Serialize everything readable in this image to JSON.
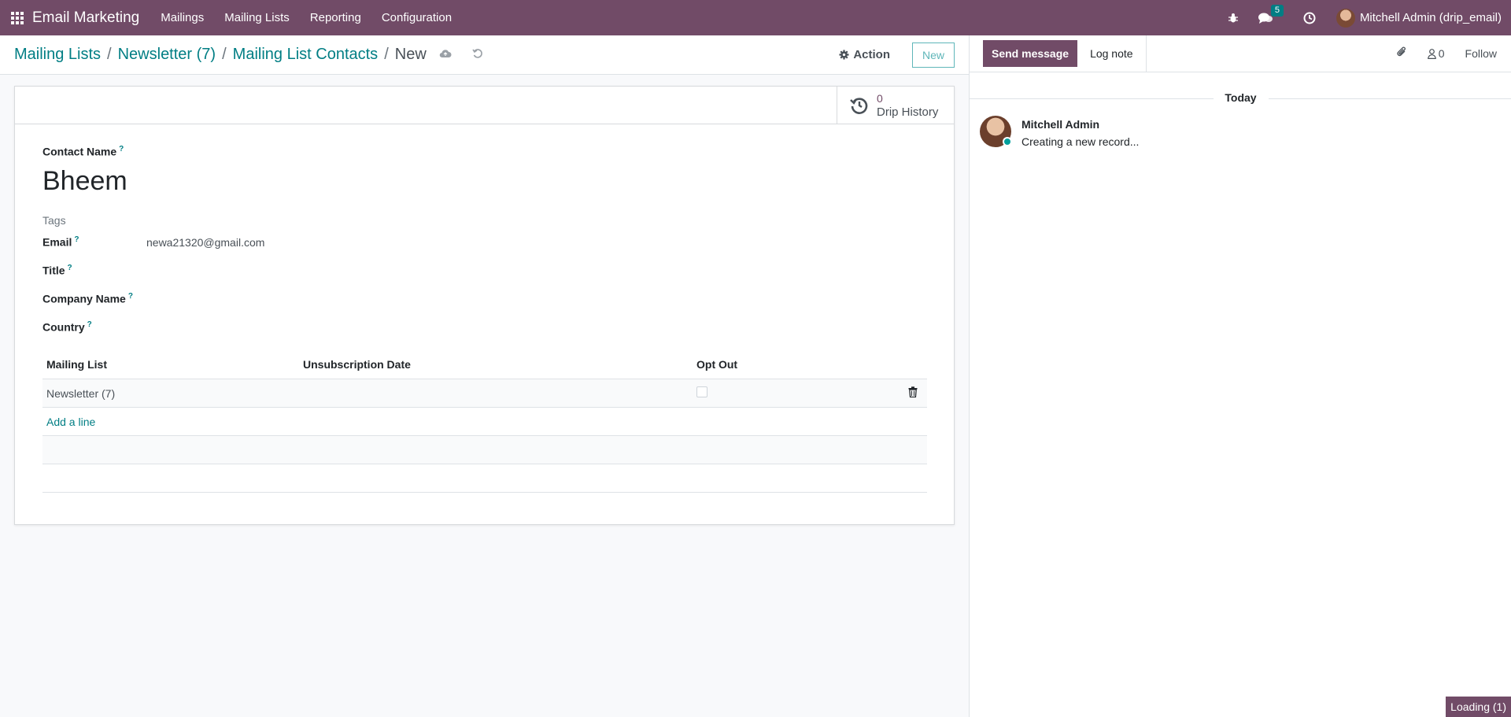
{
  "navbar": {
    "app_name": "Email Marketing",
    "menu": [
      "Mailings",
      "Mailing Lists",
      "Reporting",
      "Configuration"
    ],
    "messages_badge": "5",
    "user": "Mitchell Admin (drip_email)"
  },
  "breadcrumb": {
    "items": [
      "Mailing Lists",
      "Newsletter (7)",
      "Mailing List Contacts"
    ],
    "current": "New"
  },
  "control_panel": {
    "action_label": "Action",
    "new_label": "New"
  },
  "stat_button": {
    "value": "0",
    "label": "Drip History"
  },
  "form": {
    "contact_name_label": "Contact Name",
    "contact_name": "Bheem",
    "tags_placeholder": "Tags",
    "email_label": "Email",
    "email_value": "newa21320@gmail.com",
    "title_label": "Title",
    "company_label": "Company Name",
    "country_label": "Country",
    "help_mark": "?"
  },
  "lines": {
    "columns": [
      "Mailing List",
      "Unsubscription Date",
      "Opt Out"
    ],
    "rows": [
      {
        "mailing_list": "Newsletter (7)",
        "unsubscription_date": "",
        "opt_out": false
      }
    ],
    "add_line": "Add a line"
  },
  "chatter": {
    "send_message": "Send message",
    "log_note": "Log note",
    "followers_count": "0",
    "follow": "Follow",
    "date_separator": "Today",
    "messages": [
      {
        "author": "Mitchell Admin",
        "body": "Creating a new record..."
      }
    ]
  },
  "status": {
    "loading": "Loading (1)"
  },
  "colors": {
    "brand": "#714b67",
    "accent": "#017e84"
  }
}
